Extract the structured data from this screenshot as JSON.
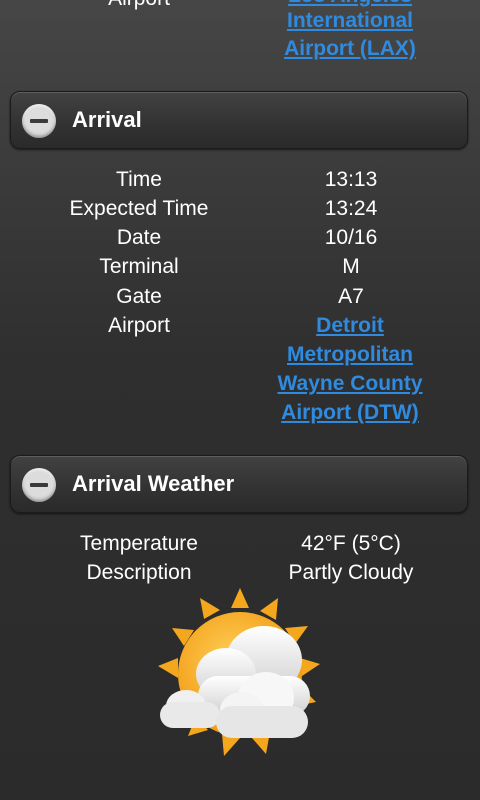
{
  "departure": {
    "partial_label": "Airport",
    "airport_lines": [
      "Los Angeles",
      "International",
      "Airport (LAX)"
    ]
  },
  "arrival": {
    "title": "Arrival",
    "rows": [
      {
        "label": "Time",
        "value": "13:13"
      },
      {
        "label": "Expected Time",
        "value": "13:24"
      },
      {
        "label": "Date",
        "value": "10/16"
      },
      {
        "label": "Terminal",
        "value": "M"
      },
      {
        "label": "Gate",
        "value": "A7"
      }
    ],
    "airport_label": "Airport",
    "airport_lines": [
      "Detroit",
      "Metropolitan",
      "Wayne County",
      "Airport (DTW)"
    ]
  },
  "arrival_weather": {
    "title": "Arrival Weather",
    "rows": [
      {
        "label": "Temperature",
        "value": "42°F (5°C)"
      },
      {
        "label": "Description",
        "value": "Partly Cloudy"
      }
    ],
    "icon": "partly-cloudy-icon"
  },
  "colors": {
    "link": "#2f8be0",
    "sun": "#f4a61c",
    "cloud": "#f2f2f2"
  }
}
